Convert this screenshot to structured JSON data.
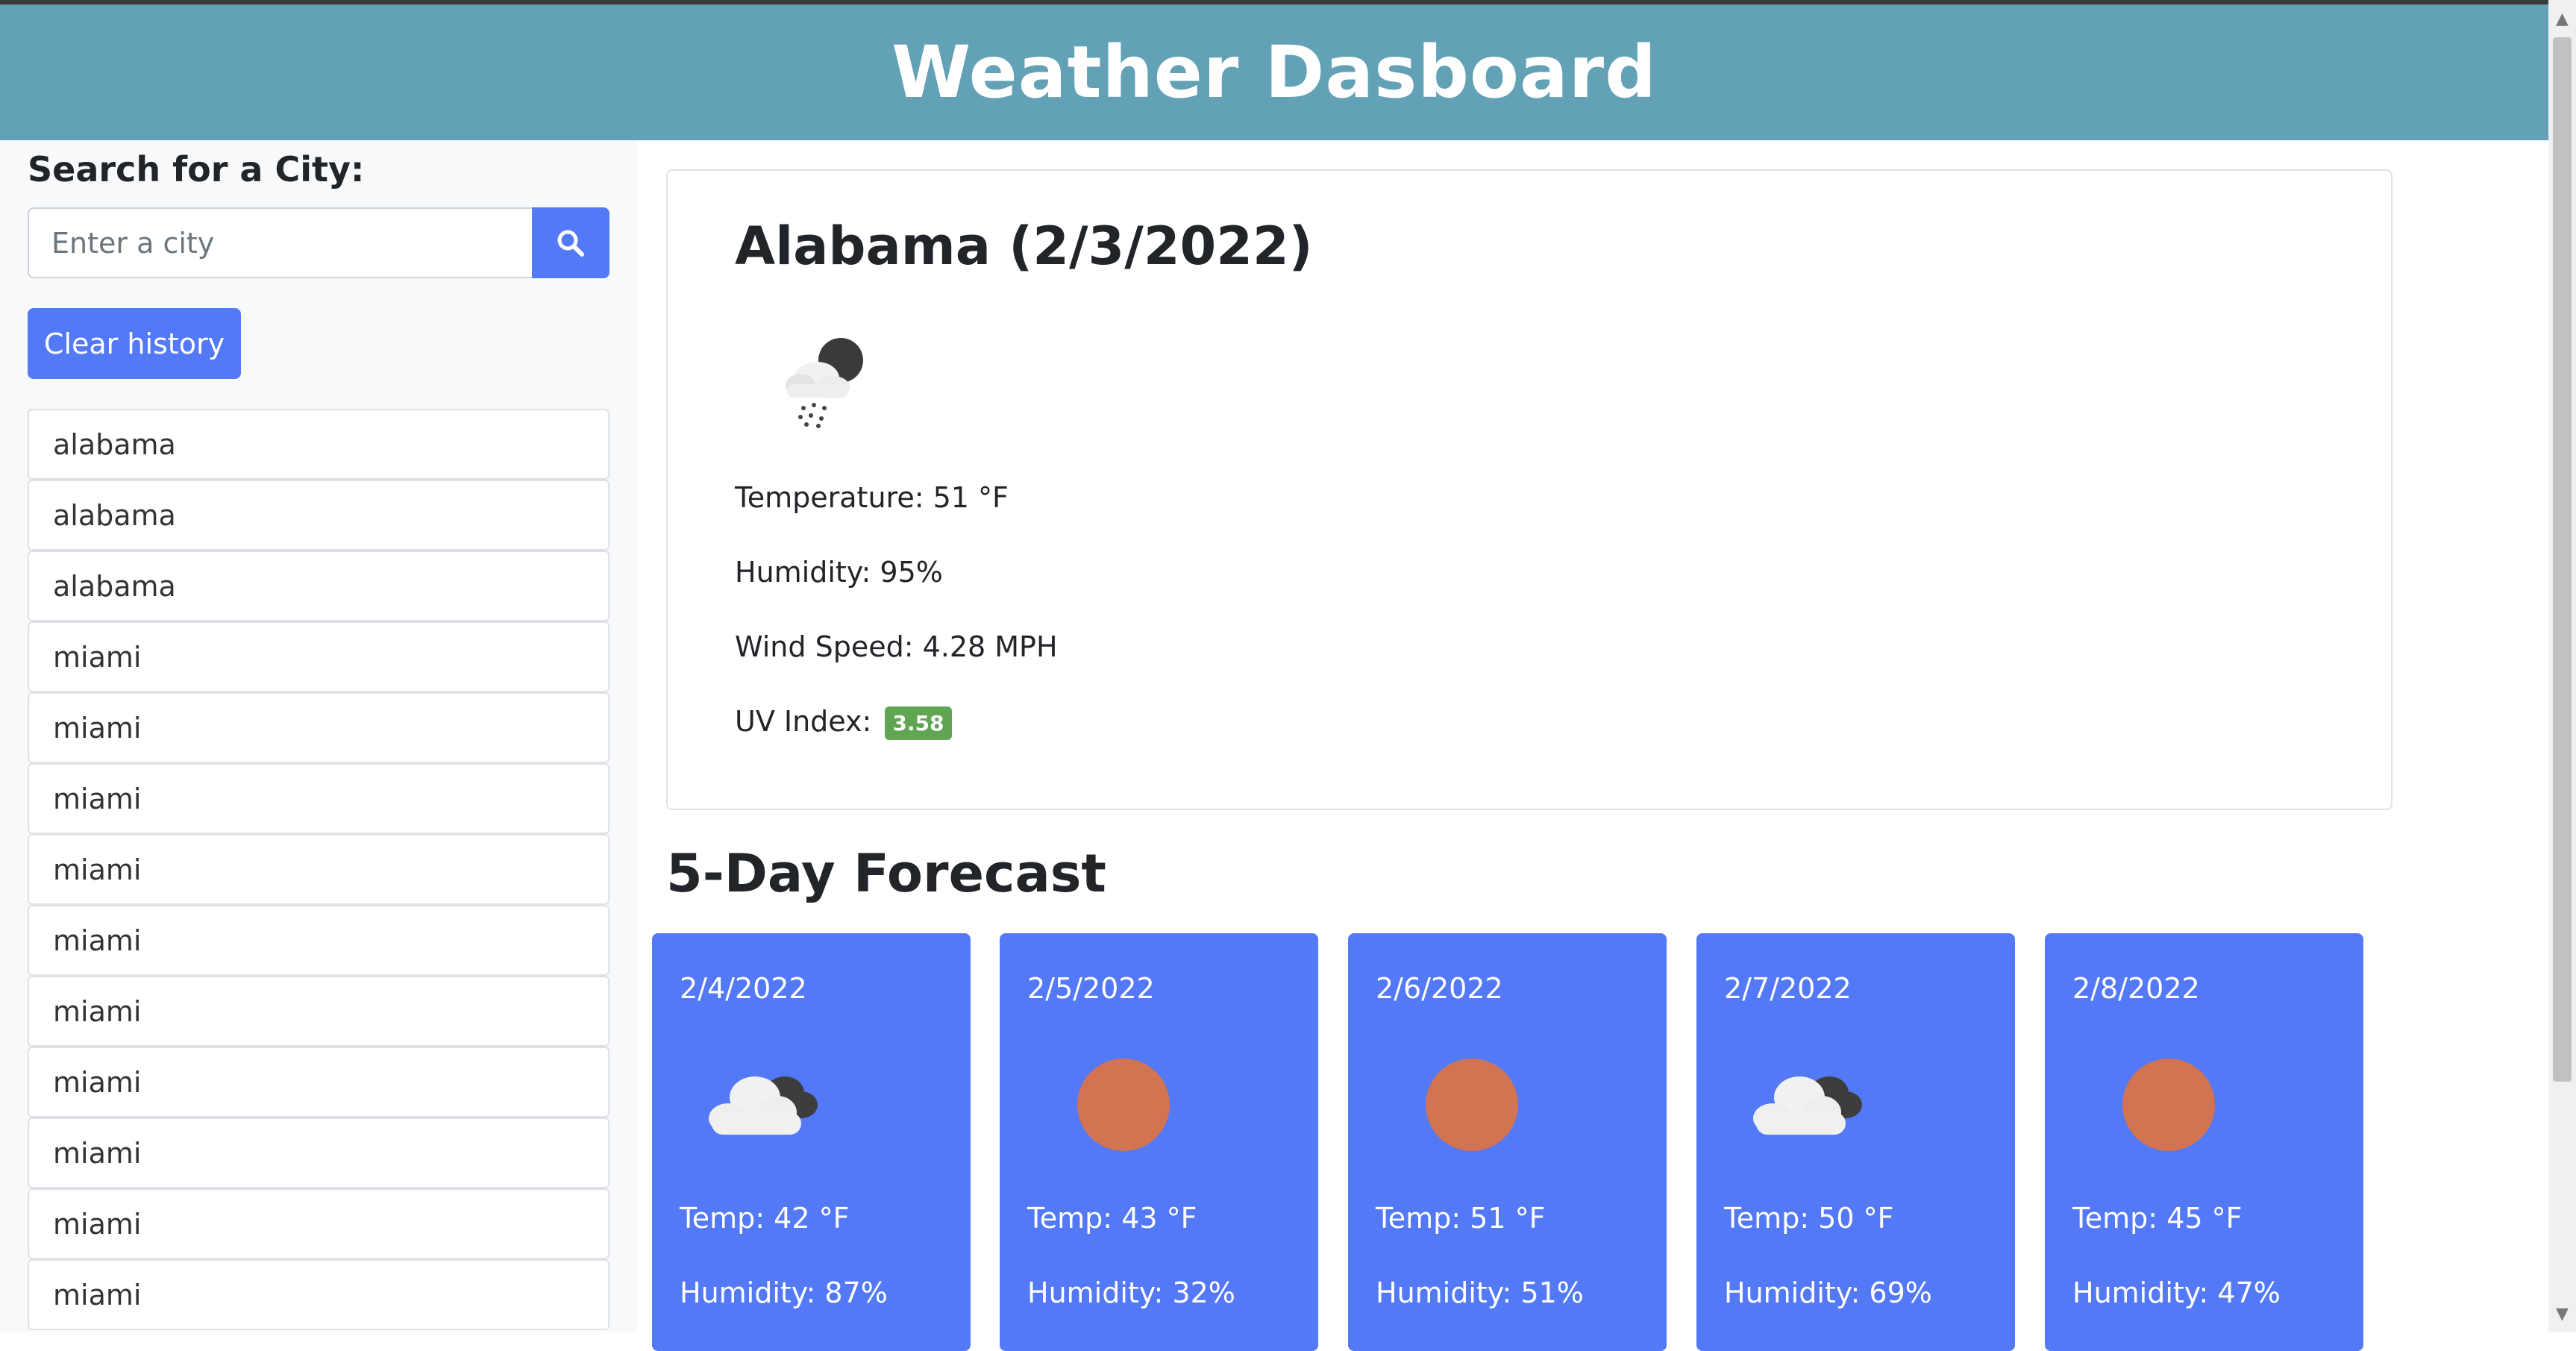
{
  "header": {
    "title": "Weather Dasboard"
  },
  "search": {
    "label": "Search for a City:",
    "placeholder": "Enter a city",
    "value": "",
    "button_icon": "search-icon"
  },
  "clear_history": {
    "label": "Clear history"
  },
  "history": [
    "alabama",
    "alabama",
    "alabama",
    "miami",
    "miami",
    "miami",
    "miami",
    "miami",
    "miami",
    "miami",
    "miami",
    "miami",
    "miami"
  ],
  "current": {
    "title": "Alabama (2/3/2022)",
    "icon": "night-rain-icon",
    "temperature": "Temperature: 51 °F",
    "humidity": "Humidity: 95%",
    "wind": "Wind Speed: 4.28 MPH",
    "uv_label": "UV Index:",
    "uv_value": "3.58",
    "uv_color": "#5fa552"
  },
  "forecast": {
    "title": "5-Day Forecast",
    "days": [
      {
        "date": "2/4/2022",
        "icon": "cloudy-icon",
        "temp": "Temp: 42 °F",
        "humidity": "Humidity: 87%"
      },
      {
        "date": "2/5/2022",
        "icon": "sun-icon",
        "temp": "Temp: 43 °F",
        "humidity": "Humidity: 32%"
      },
      {
        "date": "2/6/2022",
        "icon": "sun-icon",
        "temp": "Temp: 51 °F",
        "humidity": "Humidity: 51%"
      },
      {
        "date": "2/7/2022",
        "icon": "cloudy-icon",
        "temp": "Temp: 50 °F",
        "humidity": "Humidity: 69%"
      },
      {
        "date": "2/8/2022",
        "icon": "sun-icon",
        "temp": "Temp: 45 °F",
        "humidity": "Humidity: 47%"
      }
    ]
  },
  "colors": {
    "header_bg": "#62a1b6",
    "accent": "#5479f7",
    "uv_badge": "#5fa552"
  }
}
